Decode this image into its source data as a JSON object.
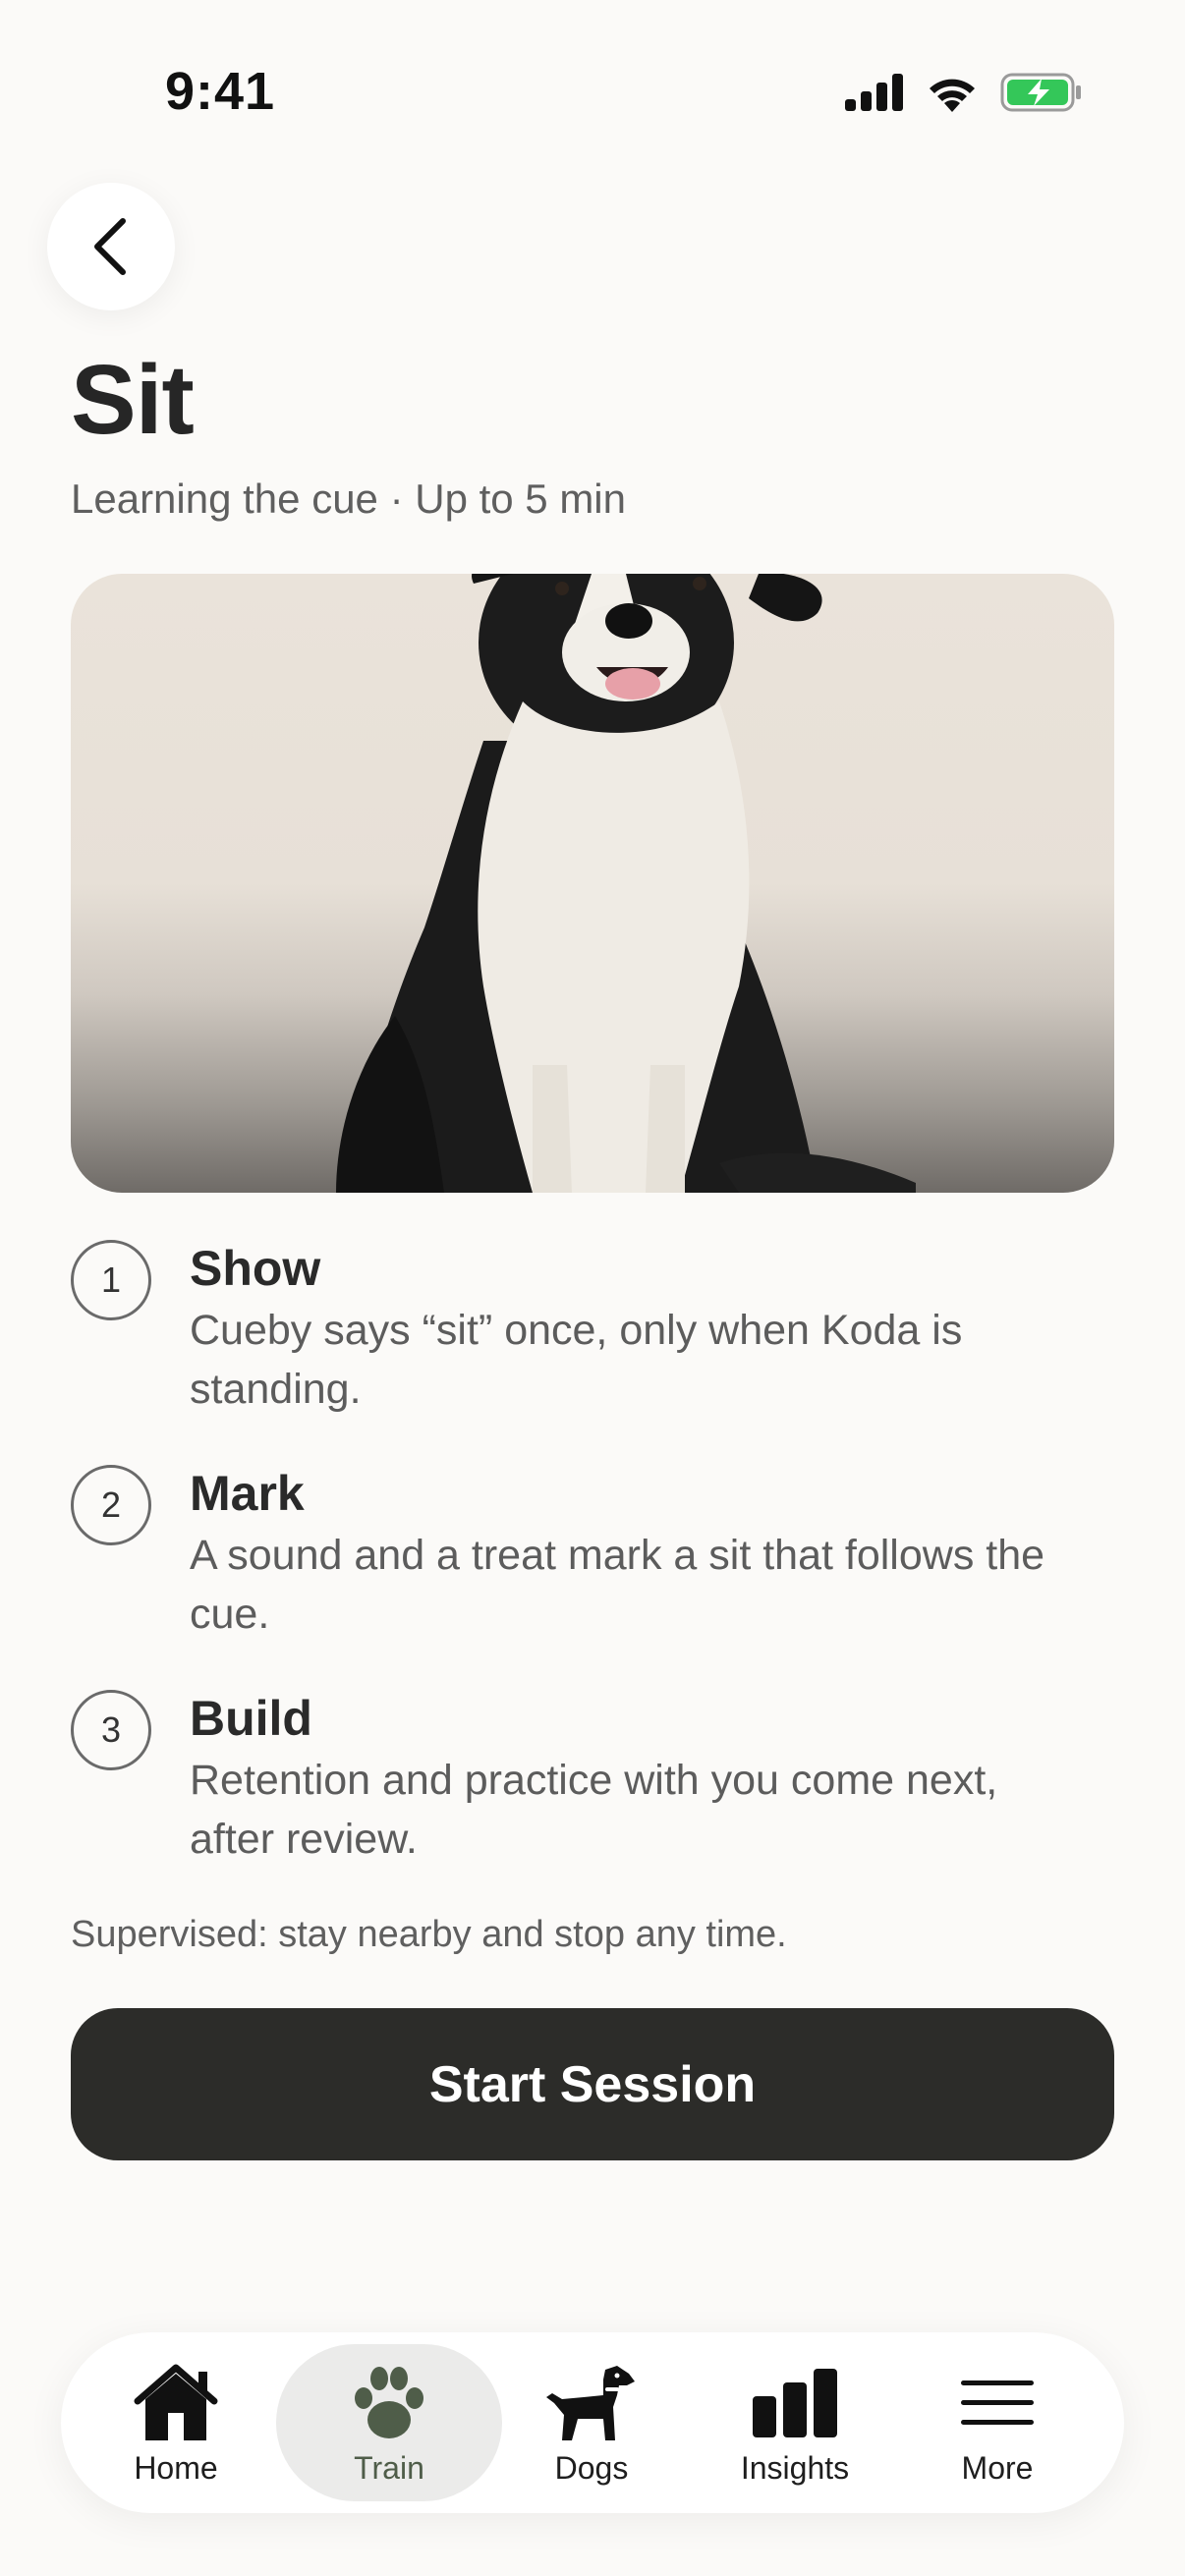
{
  "status_bar": {
    "time": "9:41"
  },
  "header": {
    "title": "Sit",
    "subtitle": "Learning the cue · Up to 5 min"
  },
  "hero_image": {
    "subject": "black-and-white border collie sitting"
  },
  "steps": [
    {
      "number": "1",
      "title": "Show",
      "description": "Cueby says “sit” once, only when Koda is standing."
    },
    {
      "number": "2",
      "title": "Mark",
      "description": "A sound and a treat mark a sit that follows the cue."
    },
    {
      "number": "3",
      "title": "Build",
      "description": "Retention and practice with you come next, after review."
    }
  ],
  "note": "Supervised: stay nearby and stop any time.",
  "cta": {
    "label": "Start Session"
  },
  "tabbar": {
    "items": [
      {
        "label": "Home",
        "icon": "home-icon"
      },
      {
        "label": "Train",
        "icon": "paw-icon",
        "active": true
      },
      {
        "label": "Dogs",
        "icon": "dog-icon"
      },
      {
        "label": "Insights",
        "icon": "bar-chart-icon"
      },
      {
        "label": "More",
        "icon": "menu-icon"
      }
    ]
  },
  "colors": {
    "primary_button": "#2c2c29",
    "active_tab_accent": "#4f5d49",
    "battery_green": "#34c759"
  }
}
